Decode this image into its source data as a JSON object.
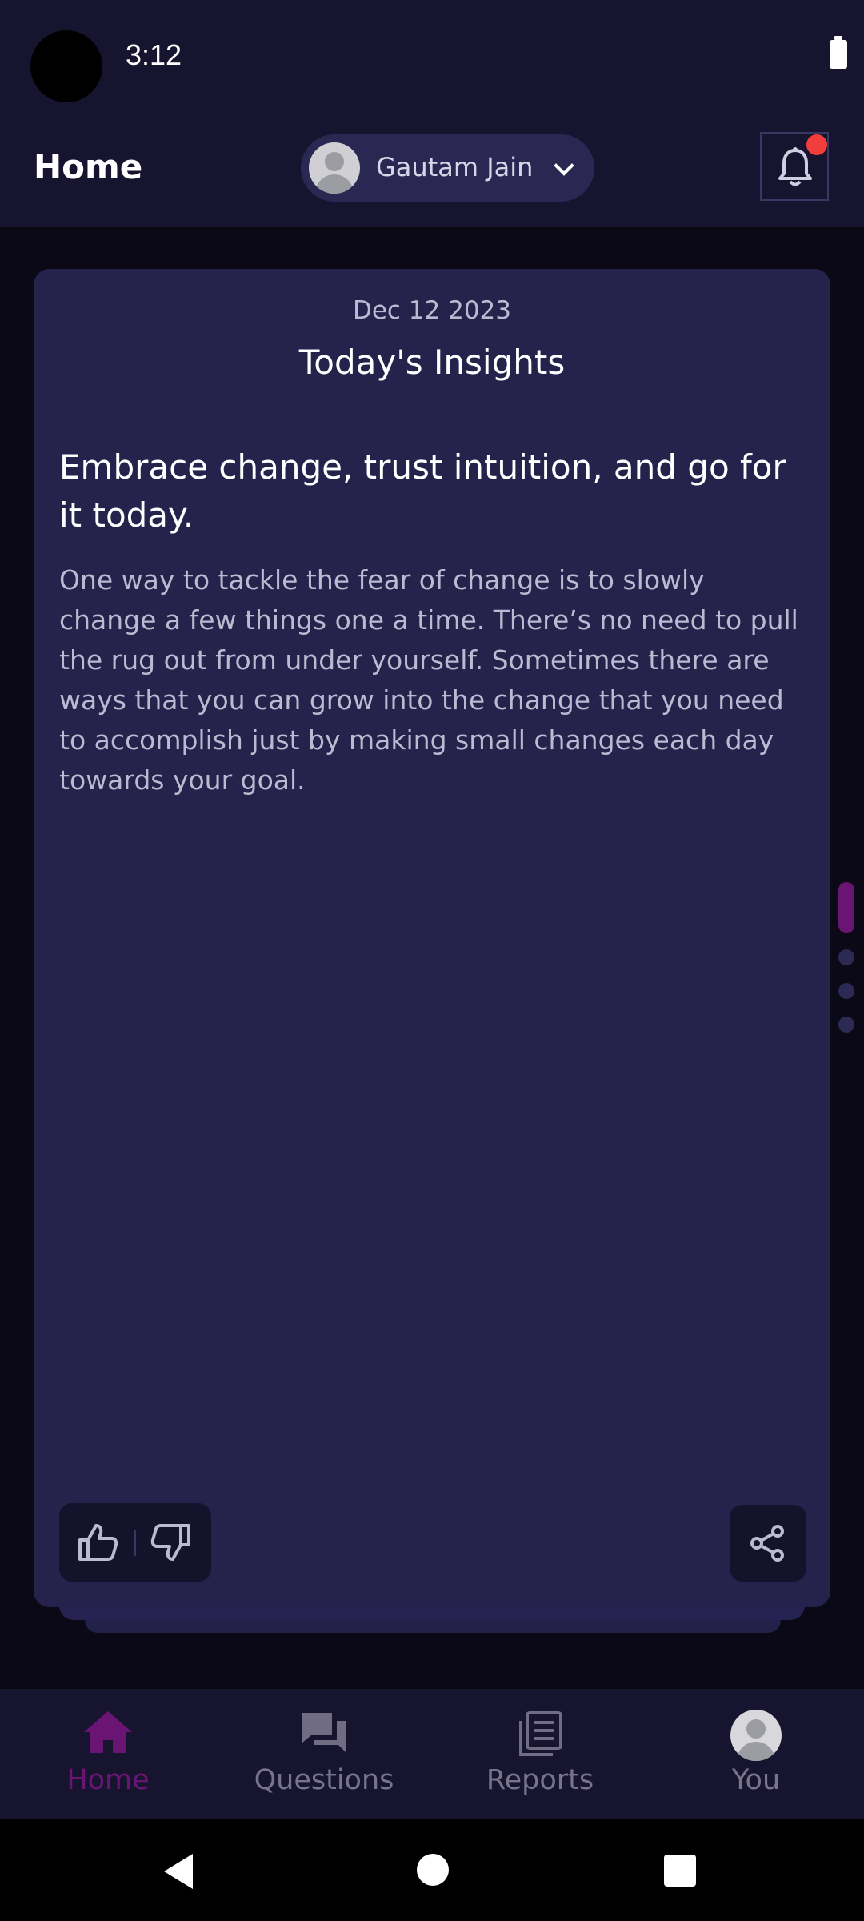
{
  "status_bar": {
    "time": "3:12"
  },
  "header": {
    "title": "Home",
    "profile_name": "Gautam Jain",
    "notification_badge_color": "#f23d3d"
  },
  "card": {
    "date": "Dec 12 2023",
    "heading": "Today's Insights",
    "insight_title": "Embrace change, trust intuition, and go for it today.",
    "insight_body": "One way to tackle the fear of change is to slowly change a few things one a time. There’s no need to pull the rug out from under yourself. Sometimes there are ways that you can grow into the change that you need to accomplish just by making small changes each day towards your goal."
  },
  "pager": {
    "total": 4,
    "active_index": 0,
    "active_color": "#6a1473"
  },
  "bottom_nav": {
    "active_color": "#6a1473",
    "items": [
      {
        "label": "Home",
        "icon": "home-icon",
        "active": true
      },
      {
        "label": "Questions",
        "icon": "chat-bubbles-icon",
        "active": false
      },
      {
        "label": "Reports",
        "icon": "newspaper-icon",
        "active": false
      },
      {
        "label": "You",
        "icon": "avatar",
        "active": false
      }
    ]
  }
}
